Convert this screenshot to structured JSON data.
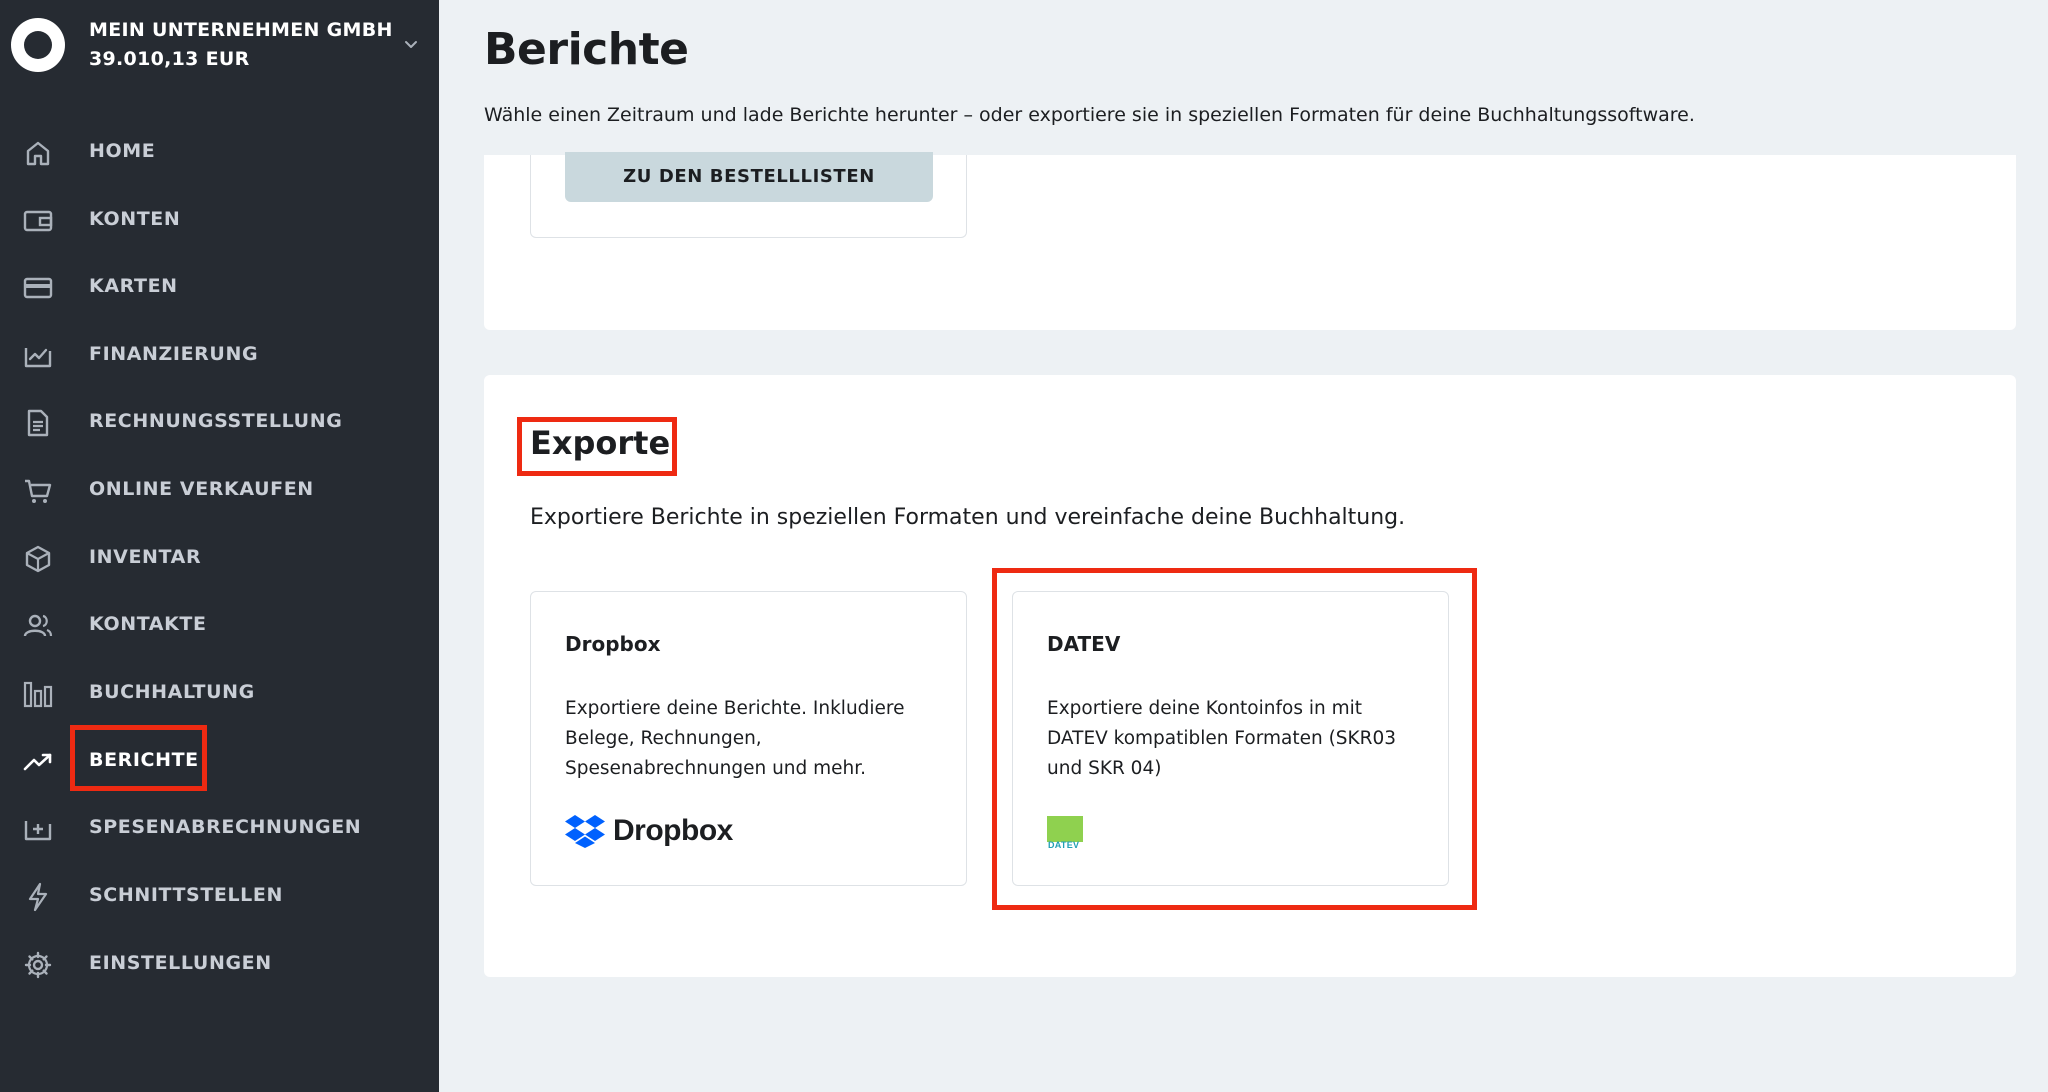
{
  "sidebar": {
    "company_name": "MEIN UNTERNEHMEN GMBH",
    "company_balance": "39.010,13 EUR",
    "items": [
      {
        "label": "HOME",
        "icon": "home-icon"
      },
      {
        "label": "KONTEN",
        "icon": "wallet-icon"
      },
      {
        "label": "KARTEN",
        "icon": "card-icon"
      },
      {
        "label": "FINANZIERUNG",
        "icon": "financing-icon"
      },
      {
        "label": "RECHNUNGSSTELLUNG",
        "icon": "document-icon"
      },
      {
        "label": "ONLINE VERKAUFEN",
        "icon": "cart-icon"
      },
      {
        "label": "INVENTAR",
        "icon": "box-icon"
      },
      {
        "label": "KONTAKTE",
        "icon": "contacts-icon"
      },
      {
        "label": "BUCHHALTUNG",
        "icon": "bar-chart-icon"
      },
      {
        "label": "BERICHTE",
        "icon": "trend-up-icon",
        "active": true
      },
      {
        "label": "SPESENABRECHNUNGEN",
        "icon": "expense-icon"
      },
      {
        "label": "SCHNITTSTELLEN",
        "icon": "lightning-icon"
      },
      {
        "label": "EINSTELLUNGEN",
        "icon": "gear-icon"
      }
    ]
  },
  "header": {
    "title": "Berichte",
    "subtitle": "Wähle einen Zeitraum und lade Berichte herunter – oder exportiere sie in speziellen Formaten für deine Buchhaltungssoftware."
  },
  "orders": {
    "button_label": "ZU DEN BESTELLLISTEN"
  },
  "exports": {
    "title": "Exporte",
    "description": "Exportiere Berichte in speziellen Formaten und vereinfache deine Buchhaltung.",
    "cards": [
      {
        "title": "Dropbox",
        "description": "Exportiere deine Berichte. Inkludiere Belege, Rechnungen, Spesenabrechnungen und mehr.",
        "logo_text": "Dropbox"
      },
      {
        "title": "DATEV",
        "description": "Exportiere deine Kontoinfos in mit DATEV kompatiblen Formaten (SKR03 und SKR 04)",
        "logo_text": "DATEV"
      }
    ]
  },
  "colors": {
    "sidebar_bg": "#262b32",
    "page_bg": "#edf1f4",
    "highlight": "#ee2a12",
    "dropbox_blue": "#0061fe",
    "datev_green": "#8fd14f"
  }
}
